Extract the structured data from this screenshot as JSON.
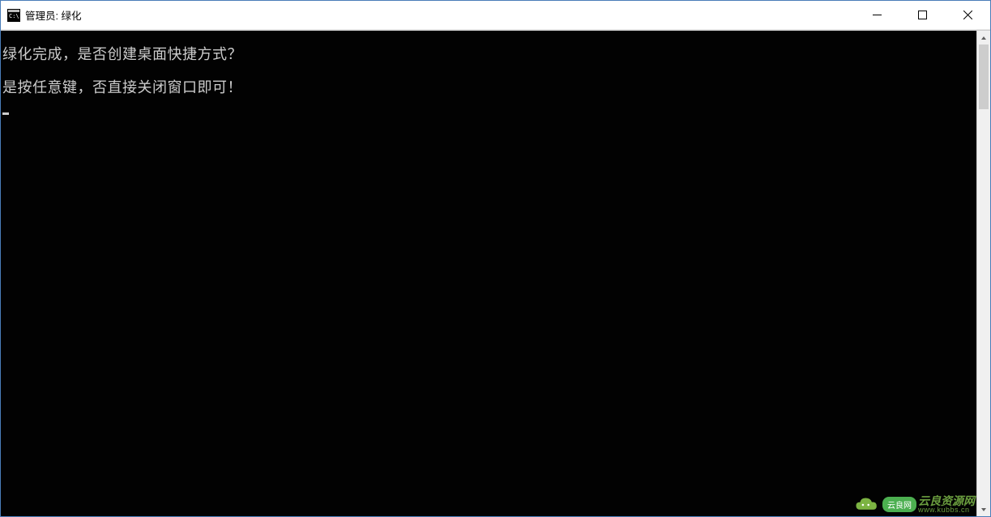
{
  "window": {
    "title": "管理员: 绿化"
  },
  "console": {
    "lines": [
      "绿化完成，是否创建桌面快捷方式？",
      "是按任意键，否直接关闭窗口即可！"
    ]
  },
  "watermark": {
    "badge": "云良网",
    "name": "云良资源网",
    "url": "www.kubbs.cn"
  }
}
